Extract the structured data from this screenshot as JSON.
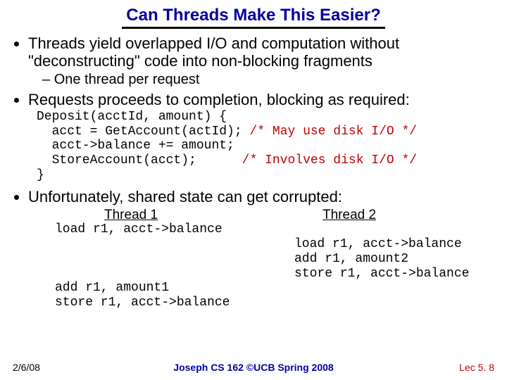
{
  "title": "Can Threads Make This Easier?",
  "bullets": {
    "b1": "Threads yield overlapped I/O and computation without \"deconstructing\" code into non-blocking fragments",
    "b1_sub": "One thread per request",
    "b2": "Requests proceeds to completion, blocking as required:",
    "b3": "Unfortunately, shared state can get corrupted:"
  },
  "code": {
    "l1": "Deposit(acctId, amount) {",
    "l2a": "  acct = GetAccount(actId);",
    "l2c": " /* May use disk I/O */",
    "l3": "  acct->balance += amount;",
    "l4a": "  StoreAccount(acct);     ",
    "l4c": " /* Involves disk I/O */",
    "l5": "}"
  },
  "threads": {
    "h1": "Thread 1",
    "h2": "Thread 2",
    "t1a": "load r1, acct->balance",
    "gap1": " ",
    "gap2": " ",
    "gap3": " ",
    "t1b": "add r1, amount1",
    "t1c": "store r1, acct->balance",
    "t2a": "load r1, acct->balance",
    "t2b": "add r1, amount2",
    "t2c": "store r1, acct->balance"
  },
  "footer": {
    "left": "2/6/08",
    "center": "Joseph CS 162 ©UCB Spring 2008",
    "right": "Lec 5. 8"
  }
}
